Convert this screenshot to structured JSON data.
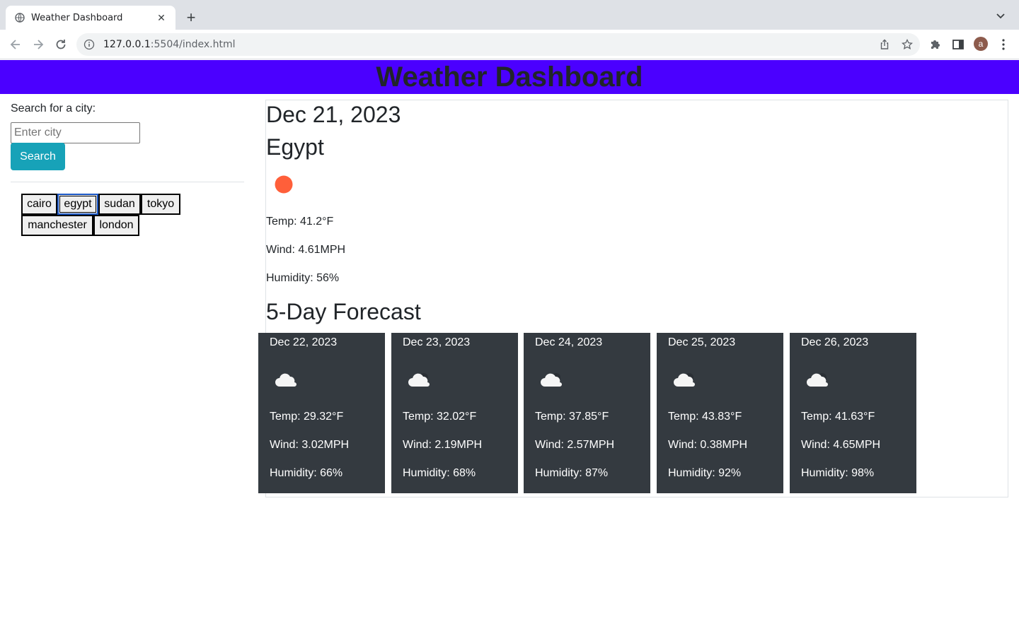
{
  "browser": {
    "tab_title": "Weather Dashboard",
    "url_host": "127.0.0.1",
    "url_rest": ":5504/index.html",
    "avatar_letter": "a"
  },
  "header": {
    "title": "Weather Dashboard",
    "bg_color": "#4b00ff"
  },
  "search": {
    "label": "Search for a city:",
    "placeholder": "Enter city",
    "button_label": "Search",
    "button_color": "#17a2b8"
  },
  "history": [
    {
      "label": "cairo"
    },
    {
      "label": "egypt"
    },
    {
      "label": "sudan"
    },
    {
      "label": "tokyo"
    },
    {
      "label": "manchester"
    },
    {
      "label": "london"
    }
  ],
  "current": {
    "date": "Dec 21, 2023",
    "city": "Egypt",
    "icon": "sun-icon",
    "temp": "Temp: 41.2°F",
    "wind": "Wind: 4.61MPH",
    "humidity": "Humidity: 56%"
  },
  "forecast": {
    "title": "5-Day Forecast",
    "card_color": "#343a40",
    "days": [
      {
        "date": "Dec 22, 2023",
        "icon": "cloud-icon",
        "temp": "Temp: 29.32°F",
        "wind": "Wind: 3.02MPH",
        "humidity": "Humidity: 66%"
      },
      {
        "date": "Dec 23, 2023",
        "icon": "cloud-icon",
        "temp": "Temp: 32.02°F",
        "wind": "Wind: 2.19MPH",
        "humidity": "Humidity: 68%"
      },
      {
        "date": "Dec 24, 2023",
        "icon": "cloud-icon",
        "temp": "Temp: 37.85°F",
        "wind": "Wind: 2.57MPH",
        "humidity": "Humidity: 87%"
      },
      {
        "date": "Dec 25, 2023",
        "icon": "cloud-icon",
        "temp": "Temp: 43.83°F",
        "wind": "Wind: 0.38MPH",
        "humidity": "Humidity: 92%"
      },
      {
        "date": "Dec 26, 2023",
        "icon": "cloud-icon",
        "temp": "Temp: 41.63°F",
        "wind": "Wind: 4.65MPH",
        "humidity": "Humidity: 98%"
      }
    ]
  }
}
